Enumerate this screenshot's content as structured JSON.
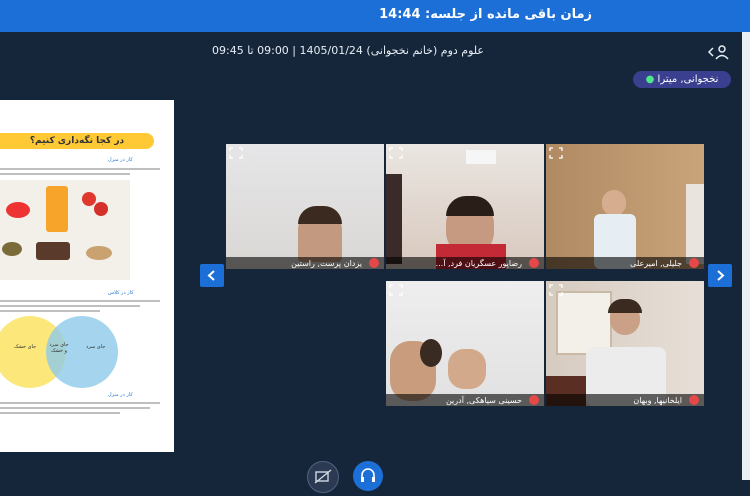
{
  "header": {
    "timer_label": "زمان باقی مانده از جلسه: 14:44"
  },
  "session": {
    "title": "علوم دوم (خانم نخجوانی) 1405/01/24 | 09:00 تا 09:45"
  },
  "speaker": {
    "name": "نخجوانی, میترا"
  },
  "slide": {
    "heading": "در کجا نگه‌داری کنیم؟",
    "section1": "کار در منزل",
    "section2": "کار در کلاس",
    "section3": "کار در منزل",
    "venn_left": "جای خشک",
    "venn_mid": "جای سرد و خشک",
    "venn_right": "جای سرد"
  },
  "participants": [
    {
      "name": "یزدان پرست, راستین"
    },
    {
      "name": "رضاپور عسگریان فرد, آ..."
    },
    {
      "name": "جلیلی, امیرعلی"
    },
    {
      "name": "حسینی سیاهکی, آدرین"
    },
    {
      "name": "ایلخانیها, وبهان"
    }
  ],
  "icons": {
    "user": "user-icon",
    "chevron": "chevron-left-icon",
    "expand": "expand-icon",
    "mic_muted": "mic-off-icon",
    "nav_prev": "chevron-left-icon",
    "nav_next": "chevron-right-icon",
    "camera_off": "camera-off-icon",
    "headset": "headset-icon"
  },
  "colors": {
    "accent": "#1b6fd6",
    "background": "#16263a",
    "muted_mic": "#e54848",
    "speaker_badge": "#3a3f8f"
  }
}
